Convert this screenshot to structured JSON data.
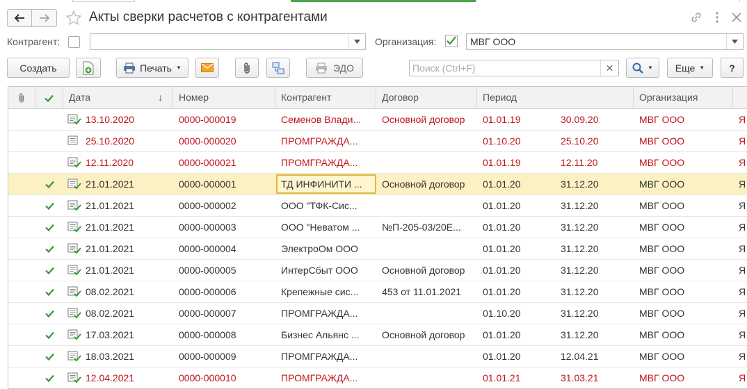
{
  "window": {
    "title": "Акты сверки расчетов с контрагентами"
  },
  "filters": {
    "counterparty_label": "Контрагент:",
    "counterparty_value": "",
    "organization_label": "Организация:",
    "organization_value": "МВГ ООО"
  },
  "toolbar": {
    "create_label": "Создать",
    "print_label": "Печать",
    "edo_label": "ЭДО",
    "search_placeholder": "Поиск (Ctrl+F)",
    "more_label": "Еще",
    "help_label": "?"
  },
  "table": {
    "columns": [
      "Дата",
      "Номер",
      "Контрагент",
      "Договор",
      "Период",
      "Организация"
    ],
    "sort_indicator": "↓",
    "rows": [
      {
        "posted": false,
        "doc": "check",
        "date": "13.10.2020",
        "number": "0000-000019",
        "counterparty": "Семенов Влади...",
        "contract": "Основной договор",
        "period_from": "01.01.19",
        "period_to": "30.09.20",
        "org": "МВГ ООО",
        "extra": "Я",
        "red": true
      },
      {
        "posted": false,
        "doc": "plain",
        "date": "25.10.2020",
        "number": "0000-000020",
        "counterparty": "ПРОМГРАЖДА...",
        "contract": "",
        "period_from": "01.10.20",
        "period_to": "25.10.20",
        "org": "МВГ ООО",
        "extra": "Я",
        "red": true
      },
      {
        "posted": false,
        "doc": "check",
        "date": "12.11.2020",
        "number": "0000-000021",
        "counterparty": "ПРОМГРАЖДА...",
        "contract": "",
        "period_from": "01.01.19",
        "period_to": "12.11.20",
        "org": "МВГ ООО",
        "extra": "Я",
        "red": true
      },
      {
        "posted": true,
        "doc": "check",
        "date": "21.01.2021",
        "number": "0000-000001",
        "counterparty": "ТД ИНФИНИТИ ...",
        "contract": "Основной договор",
        "period_from": "01.01.20",
        "period_to": "31.12.20",
        "org": "МВГ ООО",
        "extra": "Я",
        "red": false,
        "selected": true
      },
      {
        "posted": true,
        "doc": "check",
        "date": "21.01.2021",
        "number": "0000-000002",
        "counterparty": "ООО \"ТФК-Сис...",
        "contract": "",
        "period_from": "01.01.20",
        "period_to": "31.12.20",
        "org": "МВГ ООО",
        "extra": "Я",
        "red": false
      },
      {
        "posted": true,
        "doc": "check",
        "date": "21.01.2021",
        "number": "0000-000003",
        "counterparty": "ООО \"Нeватом ...",
        "contract": "№П-205-03/20Е...",
        "period_from": "01.01.20",
        "period_to": "31.12.20",
        "org": "МВГ ООО",
        "extra": "Я",
        "red": false
      },
      {
        "posted": true,
        "doc": "check",
        "date": "21.01.2021",
        "number": "0000-000004",
        "counterparty": "ЭлектроОм ООО",
        "contract": "",
        "period_from": "01.01.20",
        "period_to": "31.12.20",
        "org": "МВГ ООО",
        "extra": "Я",
        "red": false
      },
      {
        "posted": true,
        "doc": "check",
        "date": "21.01.2021",
        "number": "0000-000005",
        "counterparty": "ИнтерСбыт ООО",
        "contract": "Основной договор",
        "period_from": "01.01.20",
        "period_to": "31.12.20",
        "org": "МВГ ООО",
        "extra": "Я",
        "red": false
      },
      {
        "posted": true,
        "doc": "check",
        "date": "08.02.2021",
        "number": "0000-000006",
        "counterparty": "Крепежные сис...",
        "contract": "453 от 11.01.2021",
        "period_from": "01.01.20",
        "period_to": "31.12.20",
        "org": "МВГ ООО",
        "extra": "Я",
        "red": false
      },
      {
        "posted": true,
        "doc": "check",
        "date": "08.02.2021",
        "number": "0000-000007",
        "counterparty": "ПРОМГРАЖДА...",
        "contract": "",
        "period_from": "01.10.20",
        "period_to": "31.12.20",
        "org": "МВГ ООО",
        "extra": "Я",
        "red": false
      },
      {
        "posted": true,
        "doc": "check",
        "date": "17.03.2021",
        "number": "0000-000008",
        "counterparty": "Бизнес Альянс ...",
        "contract": "Основной договор",
        "period_from": "01.01.20",
        "period_to": "31.12.20",
        "org": "МВГ ООО",
        "extra": "Я",
        "red": false
      },
      {
        "posted": true,
        "doc": "check",
        "date": "18.03.2021",
        "number": "0000-000009",
        "counterparty": "ПРОМГРАЖДА...",
        "contract": "",
        "period_from": "01.01.20",
        "period_to": "12.04.21",
        "org": "МВГ ООО",
        "extra": "Я",
        "red": false
      },
      {
        "posted": true,
        "doc": "check",
        "date": "12.04.2021",
        "number": "0000-000010",
        "counterparty": "ПРОМГРАЖДА...",
        "contract": "",
        "period_from": "01.01.21",
        "period_to": "31.03.21",
        "org": "МВГ ООО",
        "extra": "Я",
        "red": true
      }
    ]
  },
  "colors": {
    "accent_green": "#48a648",
    "posted_red": "#c0141c",
    "selected_row": "#fbf1c2"
  }
}
